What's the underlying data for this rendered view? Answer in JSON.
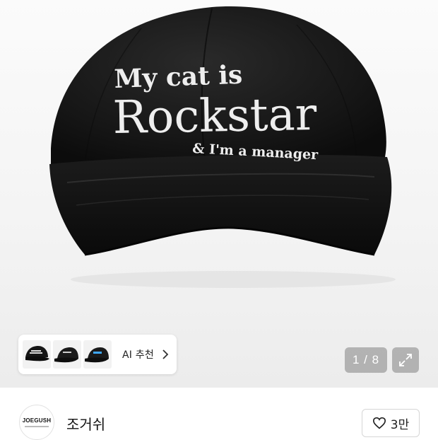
{
  "product": {
    "embroidery_line1": "My cat is",
    "embroidery_line2": "Rockstar",
    "embroidery_line3": "& I'm a manager",
    "cap_color": "#141414",
    "text_color": "#eeeeee"
  },
  "recommend": {
    "label": "AI 추천",
    "thumbnails": [
      "black-cap-thumb",
      "black-cap-thumb-2",
      "black-cap-blue-logo-thumb"
    ],
    "chevron": "chevron-right-icon"
  },
  "gallery": {
    "page_indicator": "1 / 8",
    "expand_icon": "expand-icon"
  },
  "seller": {
    "logo_text": "JOEGUSH",
    "name": "조거쉬"
  },
  "like": {
    "icon": "heart-icon",
    "count": "3만"
  }
}
